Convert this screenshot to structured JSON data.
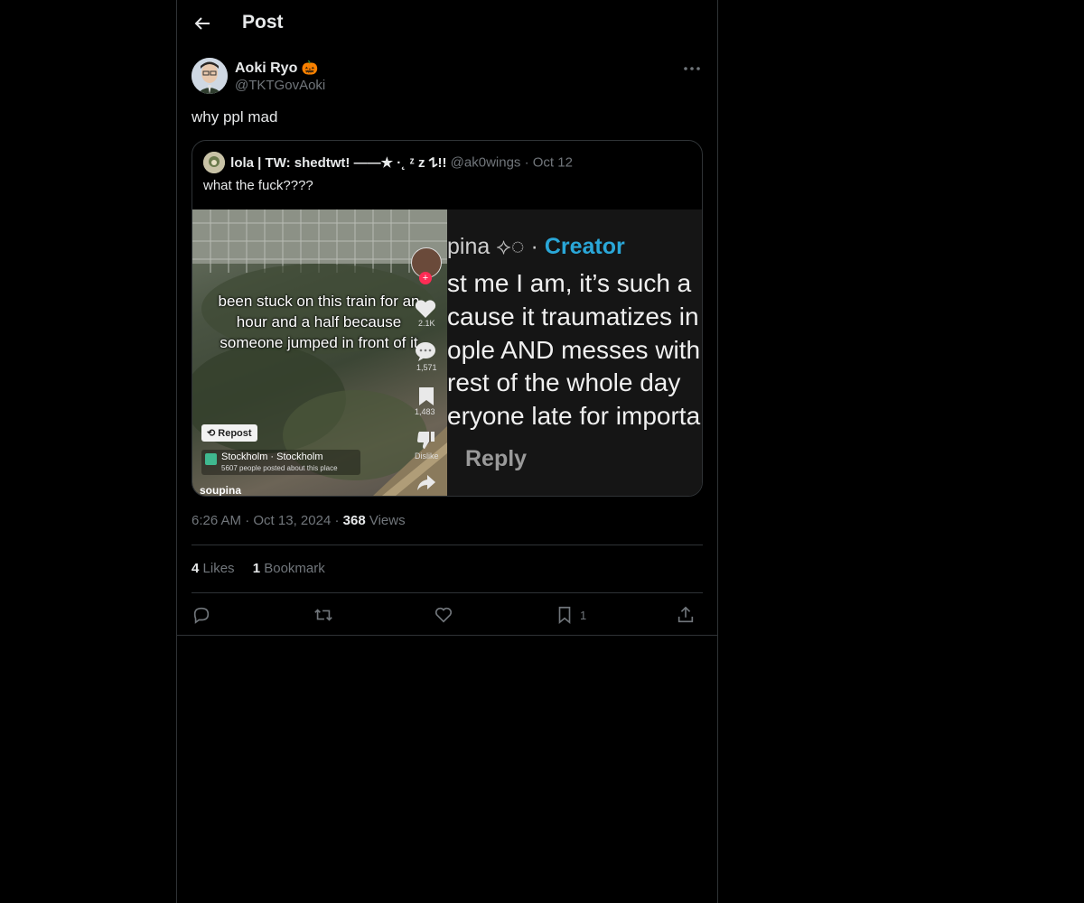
{
  "header": {
    "title": "Post"
  },
  "author": {
    "name": "Aoki Ryo",
    "emoji": "🎃",
    "handle": "@TKTGovAoki"
  },
  "post": {
    "text": "why ppl mad"
  },
  "quote": {
    "name": "lola | TW: shedtwt! ——★ ·˛ ᶻ z 𐰁!!",
    "handle": "@ak0wings",
    "separator": "·",
    "date": "Oct 12",
    "text": "what the fuck????",
    "media_left": {
      "caption": "been stuck on this train for an hour and a half because someone jumped in front of it",
      "likes": "2.1K",
      "comments": "1,571",
      "saves": "1,483",
      "dislike": "Dislike",
      "repost": "Repost",
      "location": "Stockholm · Stockholm",
      "location_sub": "5607 people posted about this place",
      "creator": "soupina"
    },
    "media_right": {
      "top_name": "pina",
      "top_sep": "·",
      "top_creator": "Creator",
      "lines": [
        "st me I am, it’s such a",
        "cause it traumatizes in",
        "ople AND messes with",
        " rest of the whole day",
        "eryone late for importa"
      ],
      "reply": "Reply"
    }
  },
  "meta": {
    "time": "6:26 AM",
    "sep1": "·",
    "date": "Oct 13, 2024",
    "sep2": "·",
    "views_count": "368",
    "views_label": "Views"
  },
  "stats": {
    "likes_count": "4",
    "likes_label": "Likes",
    "bookmarks_count": "1",
    "bookmarks_label": "Bookmark"
  },
  "actions": {
    "bookmark_count": "1"
  },
  "colors": {
    "background": "#000000",
    "border": "#2f3336",
    "muted": "#71767b",
    "text": "#e7e9ea",
    "creator_blue": "#2aa7d8"
  }
}
